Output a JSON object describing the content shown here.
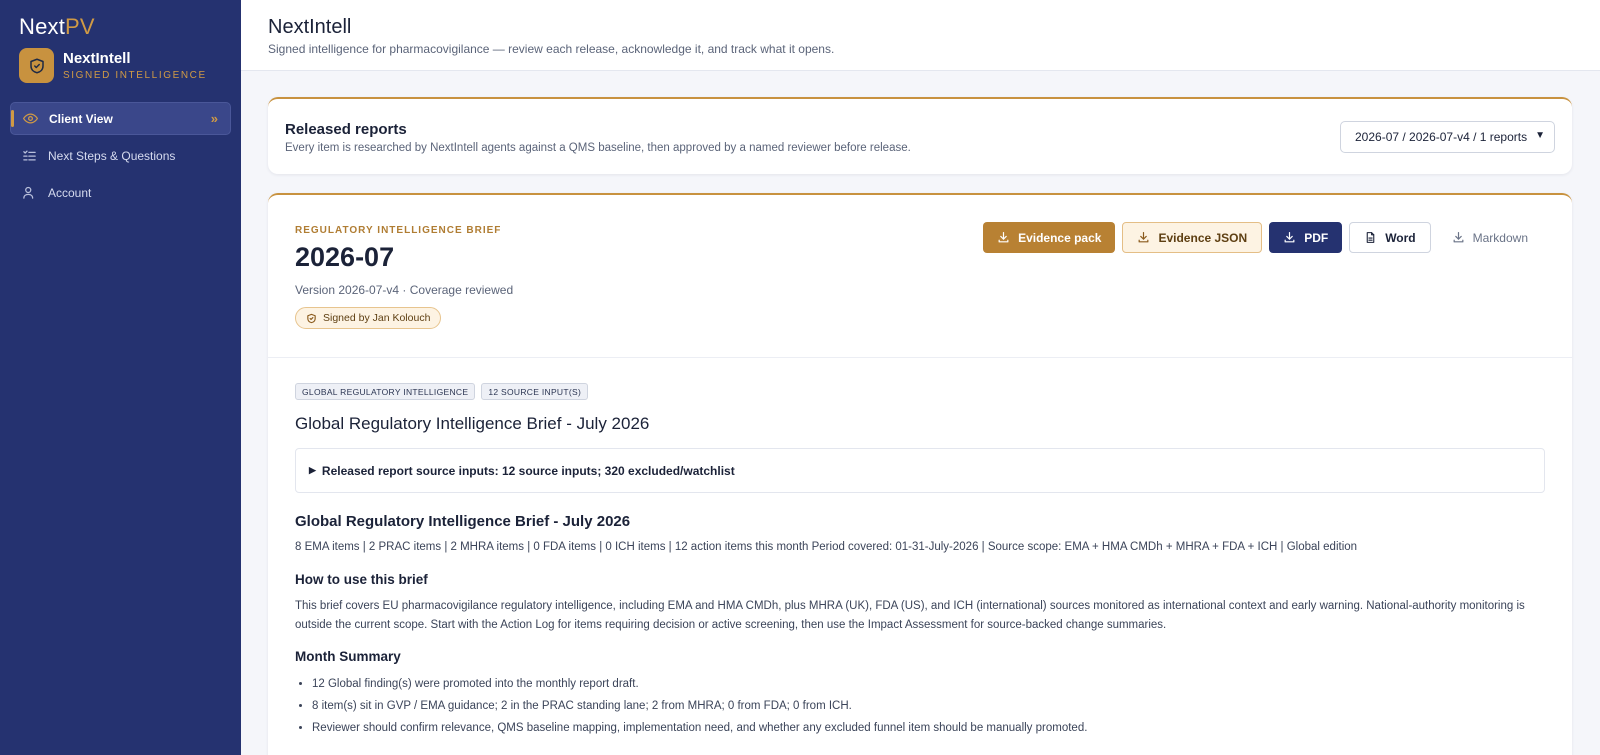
{
  "sidebar": {
    "logo_main": "Next",
    "logo_accent": "PV",
    "brand_name": "NextIntell",
    "brand_sub": "SIGNED INTELLIGENCE",
    "items": [
      {
        "label": "Client View",
        "icon": "eye-icon",
        "active": true
      },
      {
        "label": "Next Steps & Questions",
        "icon": "list-check-icon"
      },
      {
        "label": "Account",
        "icon": "user-icon"
      }
    ]
  },
  "header": {
    "title": "NextIntell",
    "subtitle": "Signed intelligence for pharmacovigilance — review each release, acknowledge it, and track what it opens."
  },
  "released": {
    "title": "Released reports",
    "subtitle": "Every item is researched by NextIntell agents against a QMS baseline, then approved by a named reviewer before release.",
    "selected": "2026-07 / 2026-07-v4 / 1 reports"
  },
  "report": {
    "kicker": "REGULATORY INTELLIGENCE BRIEF",
    "title": "2026-07",
    "version": "Version 2026-07-v4 · Coverage reviewed",
    "signed": "Signed by Jan Kolouch",
    "buttons": {
      "evidence_pack": "Evidence pack",
      "evidence_json": "Evidence JSON",
      "pdf": "PDF",
      "word": "Word",
      "markdown": "Markdown"
    },
    "chips": [
      "GLOBAL REGULATORY INTELLIGENCE",
      "12 SOURCE INPUT(S)"
    ],
    "section_title": "Global Regulatory Intelligence Brief - July 2026",
    "details_summary": "Released report source inputs: 12 source inputs; 320 excluded/watchlist",
    "h2": "Global Regulatory Intelligence Brief - July 2026",
    "meta": "8 EMA items | 2 PRAC items | 2 MHRA items | 0 FDA items | 0 ICH items | 12 action items this month Period covered: 01-31-July-2026 | Source scope: EMA + HMA CMDh + MHRA + FDA + ICH | Global edition",
    "how_title": "How to use this brief",
    "how_text": "This brief covers EU pharmacovigilance regulatory intelligence, including EMA and HMA CMDh, plus MHRA (UK), FDA (US), and ICH (international) sources monitored as international context and early warning. National-authority monitoring is outside the current scope. Start with the Action Log for items requiring decision or active screening, then use the Impact Assessment for source-backed change summaries.",
    "summary_title": "Month Summary",
    "summary_items": [
      "12 Global finding(s) were promoted into the monthly report draft.",
      "8 item(s) sit in GVP / EMA guidance; 2 in the PRAC standing lane; 2 from MHRA; 0 from FDA; 0 from ICH.",
      "Reviewer should confirm relevance, QMS baseline mapping, implementation need, and whether any excluded funnel item should be manually promoted."
    ]
  }
}
